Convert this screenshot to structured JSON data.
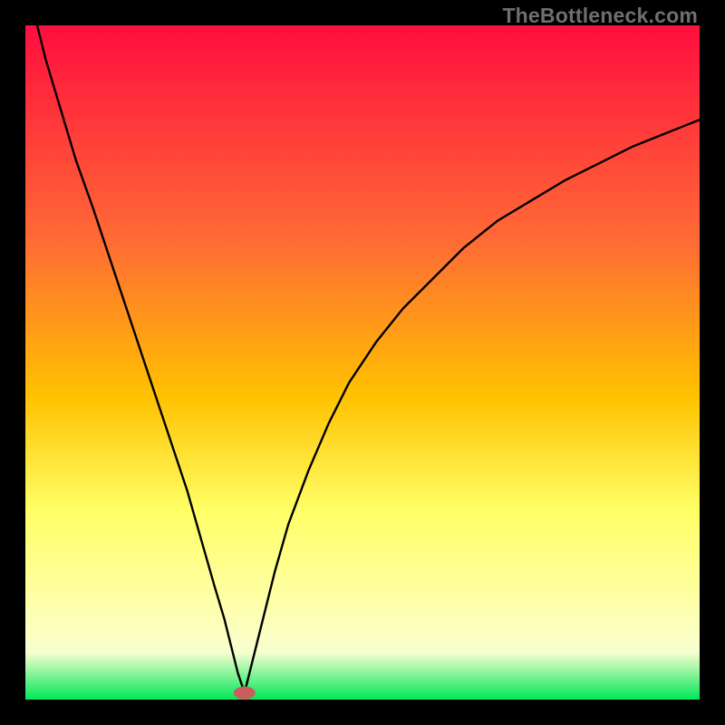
{
  "watermark": "TheBottleneck.com",
  "colors": {
    "bg": "#000000",
    "curve": "#000000",
    "marker_fill": "#cd5c5c",
    "gradient_top": "#ff0e3e",
    "gradient_mid1": "#ff6b35",
    "gradient_mid2": "#ffc200",
    "gradient_mid3": "#ffff66",
    "gradient_mid4": "#ffffa6",
    "gradient_bot": "#00e756"
  },
  "chart_data": {
    "type": "line",
    "title": "",
    "xlabel": "",
    "ylabel": "",
    "xlim": [
      0,
      100
    ],
    "ylim": [
      0,
      100
    ],
    "series": [
      {
        "name": "left-branch",
        "x": [
          0,
          1.5,
          3,
          4.5,
          6,
          7.5,
          10,
          12,
          14,
          16,
          18,
          20,
          22,
          24,
          26,
          28,
          29.5,
          30.5,
          31.5,
          32.5
        ],
        "y": [
          110,
          101,
          95,
          90,
          85,
          80,
          73,
          67,
          61,
          55,
          49,
          43,
          37,
          31,
          24,
          17,
          12,
          8,
          4,
          1
        ]
      },
      {
        "name": "right-branch",
        "x": [
          32.5,
          33.5,
          35,
          37,
          39,
          42,
          45,
          48,
          52,
          56,
          60,
          65,
          70,
          75,
          80,
          85,
          90,
          95,
          100
        ],
        "y": [
          1,
          5,
          11,
          19,
          26,
          34,
          41,
          47,
          53,
          58,
          62,
          67,
          71,
          74,
          77,
          79.5,
          82,
          84,
          86
        ]
      }
    ],
    "marker": {
      "x": 32.5,
      "y": 1,
      "rx": 1.6,
      "ry": 0.95
    }
  }
}
